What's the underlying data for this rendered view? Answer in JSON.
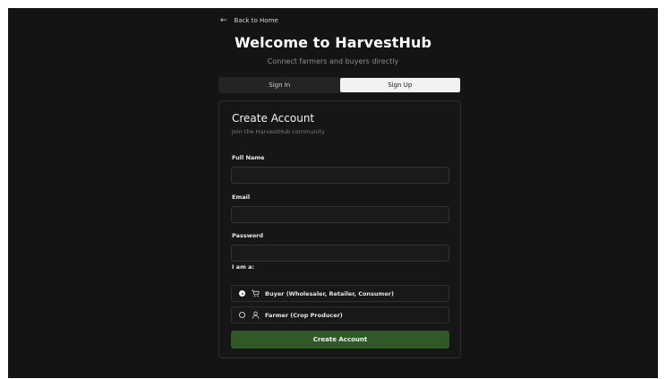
{
  "back_link": "Back to Home",
  "header": {
    "title": "Welcome to HarvestHub",
    "subtitle": "Connect farmers and buyers directly"
  },
  "tabs": [
    {
      "label": "Sign In",
      "active": false
    },
    {
      "label": "Sign Up",
      "active": true
    }
  ],
  "card": {
    "title": "Create Account",
    "subtitle": "Join the HarvestHub community"
  },
  "fields": {
    "full_name": {
      "label": "Full Name",
      "value": "",
      "placeholder": ""
    },
    "email": {
      "label": "Email",
      "value": "",
      "placeholder": ""
    },
    "password": {
      "label": "Password",
      "value": "",
      "placeholder": ""
    }
  },
  "role": {
    "label": "I am a:",
    "options": [
      {
        "label": "Buyer (Wholesaler, Retailer, Consumer)",
        "icon": "cart-icon",
        "selected": true
      },
      {
        "label": "Farmer (Crop Producer)",
        "icon": "user-icon",
        "selected": false
      }
    ]
  },
  "submit_label": "Create Account",
  "colors": {
    "background": "#141414",
    "accent": "#2f5a28",
    "active_tab": "#f2f2f2"
  }
}
